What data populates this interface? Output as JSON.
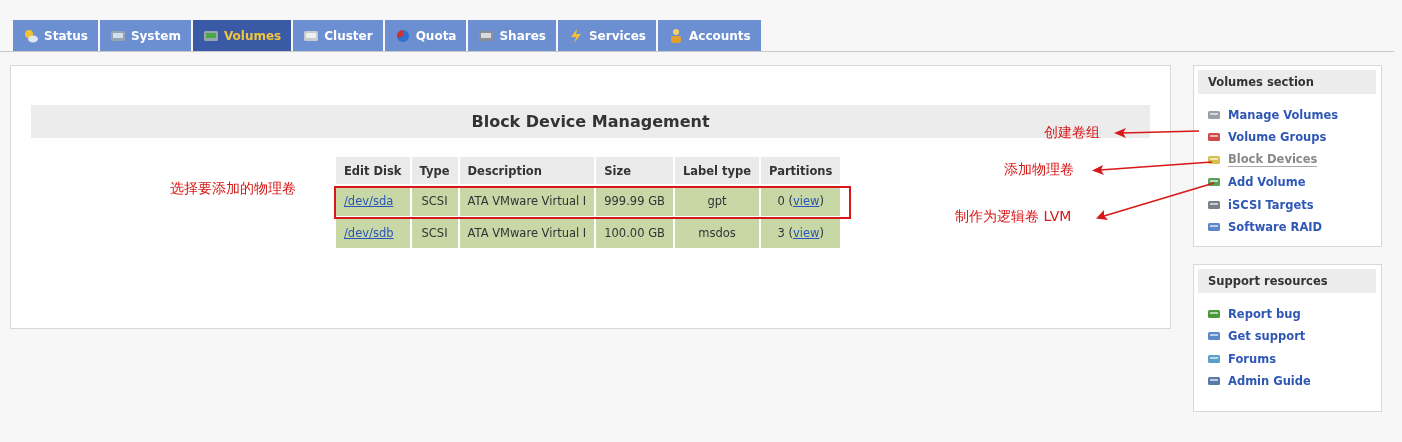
{
  "tabs": [
    {
      "label": "Status",
      "selected": false
    },
    {
      "label": "System",
      "selected": false
    },
    {
      "label": "Volumes",
      "selected": true
    },
    {
      "label": "Cluster",
      "selected": false
    },
    {
      "label": "Quota",
      "selected": false
    },
    {
      "label": "Shares",
      "selected": false
    },
    {
      "label": "Services",
      "selected": false
    },
    {
      "label": "Accounts",
      "selected": false
    }
  ],
  "main": {
    "title": "Block Device Management",
    "table": {
      "columns": [
        "Edit Disk",
        "Type",
        "Description",
        "Size",
        "Label type",
        "Partitions"
      ],
      "rows": [
        {
          "disk": "/dev/sda",
          "type": "SCSI",
          "description": "ATA VMware Virtual I",
          "size": "999.99 GB",
          "label_type": "gpt",
          "partitions": "0 (",
          "view": "view",
          "partitions_end": ")",
          "highlighted": true
        },
        {
          "disk": "/dev/sdb",
          "type": "SCSI",
          "description": "ATA VMware Virtual I",
          "size": "100.00 GB",
          "label_type": "msdos",
          "partitions": "3 (",
          "view": "view",
          "partitions_end": ")",
          "highlighted": false
        }
      ]
    }
  },
  "sidebar": [
    {
      "title": "Volumes section",
      "items": [
        {
          "label": "Manage Volumes",
          "selected": false
        },
        {
          "label": "Volume Groups",
          "selected": false
        },
        {
          "label": "Block Devices",
          "selected": true
        },
        {
          "label": "Add Volume",
          "selected": false
        },
        {
          "label": "iSCSI Targets",
          "selected": false
        },
        {
          "label": "Software RAID",
          "selected": false
        }
      ]
    },
    {
      "title": "Support resources",
      "items": [
        {
          "label": "Report bug",
          "selected": false
        },
        {
          "label": "Get support",
          "selected": false
        },
        {
          "label": "Forums",
          "selected": false
        },
        {
          "label": "Admin Guide",
          "selected": false
        }
      ]
    }
  ],
  "annotations": [
    {
      "text": "选择要添加的物理卷"
    },
    {
      "text": "创建卷组"
    },
    {
      "text": "添加物理卷"
    },
    {
      "text": "制作为逻辑卷 LVM"
    }
  ]
}
